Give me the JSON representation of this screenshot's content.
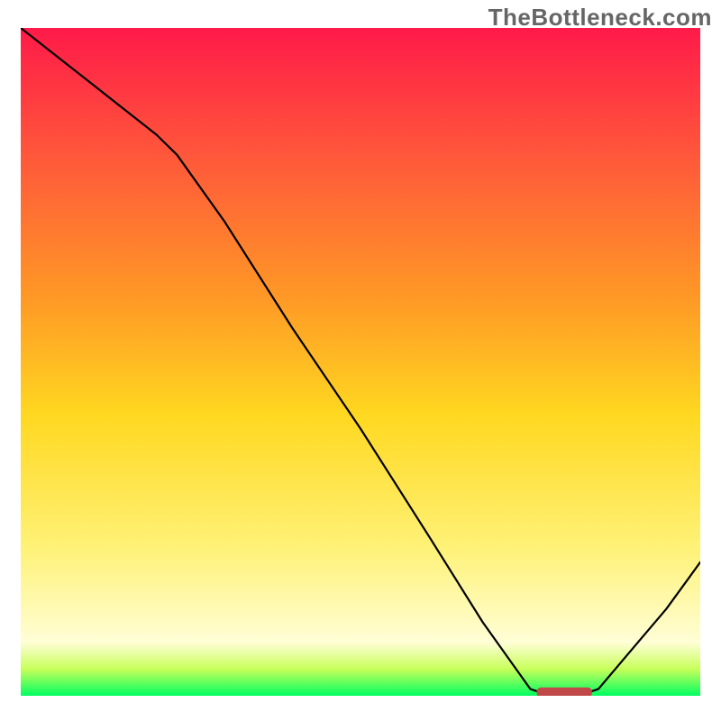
{
  "watermark": "TheBottleneck.com",
  "chart_data": {
    "type": "line",
    "title": "",
    "xlabel": "",
    "ylabel": "",
    "xlim": [
      0,
      1
    ],
    "ylim": [
      0,
      1
    ],
    "series": [
      {
        "name": "bottleneck-curve",
        "x": [
          0.0,
          0.1,
          0.2,
          0.23,
          0.3,
          0.4,
          0.5,
          0.6,
          0.68,
          0.75,
          0.78,
          0.82,
          0.85,
          0.9,
          0.95,
          1.0
        ],
        "y": [
          1.0,
          0.92,
          0.84,
          0.81,
          0.71,
          0.55,
          0.4,
          0.24,
          0.11,
          0.01,
          0.0,
          0.0,
          0.01,
          0.07,
          0.13,
          0.2
        ]
      }
    ],
    "marker": {
      "name": "optimal-range",
      "x_start": 0.76,
      "x_end": 0.84,
      "y": 0.005
    },
    "background_gradient": {
      "top": "#ff1a49",
      "middle": "#ffd820",
      "bottom": "#00ff60"
    }
  }
}
